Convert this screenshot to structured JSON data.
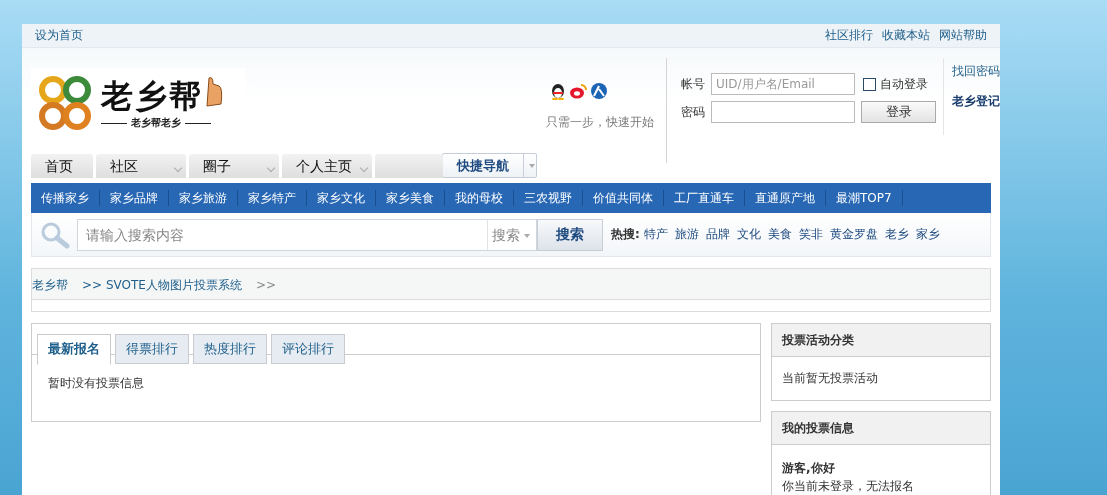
{
  "topbar": {
    "left": "设为首页",
    "right": [
      "社区排行",
      "收藏本站",
      "网站帮助"
    ]
  },
  "logo": {
    "title": "老乡帮",
    "slogan": "老乡帮老乡"
  },
  "quick_login": {
    "hint": "只需一步，快速开始"
  },
  "login": {
    "account_label": "帐号",
    "account_placeholder": "UID/用户名/Email",
    "password_label": "密码",
    "auto_login": {
      "label": "自动登录",
      "checked": false
    },
    "submit": "登录",
    "links": [
      "找回密码",
      "老乡登记"
    ]
  },
  "nav_tabs": [
    {
      "label": "首页",
      "dropdown": false
    },
    {
      "label": "社区",
      "dropdown": true
    },
    {
      "label": "圈子",
      "dropdown": true
    },
    {
      "label": "个人主页",
      "dropdown": true
    }
  ],
  "quick_nav": "快捷导航",
  "menu": [
    "传播家乡",
    "家乡品牌",
    "家乡旅游",
    "家乡特产",
    "家乡文化",
    "家乡美食",
    "我的母校",
    "三农视野",
    "价值共同体",
    "工厂直通车",
    "直通原产地",
    "最潮TOP7"
  ],
  "search": {
    "placeholder": "请输入搜索内容",
    "scope": "搜索",
    "button": "搜索",
    "hot_label": "热搜:",
    "hot": [
      "特产",
      "旅游",
      "品牌",
      "文化",
      "美食",
      "笑非",
      "黄金罗盘",
      "老乡",
      "家乡"
    ]
  },
  "breadcrumb": [
    "老乡帮",
    ">> SVOTE人物图片投票系统",
    ">>"
  ],
  "tabs": [
    {
      "label": "最新报名",
      "selected": true
    },
    {
      "label": "得票排行",
      "selected": false
    },
    {
      "label": "热度排行",
      "selected": false
    },
    {
      "label": "评论排行",
      "selected": false
    }
  ],
  "tab_content": "暂时没有投票信息",
  "sidebar": [
    {
      "title": "投票活动分类",
      "kind": "text",
      "lines": [
        "当前暂无投票活动"
      ]
    },
    {
      "title": "我的投票信息",
      "kind": "greeting",
      "lines": [
        "游客,你好",
        "你当前未登录，无法报名"
      ]
    }
  ]
}
